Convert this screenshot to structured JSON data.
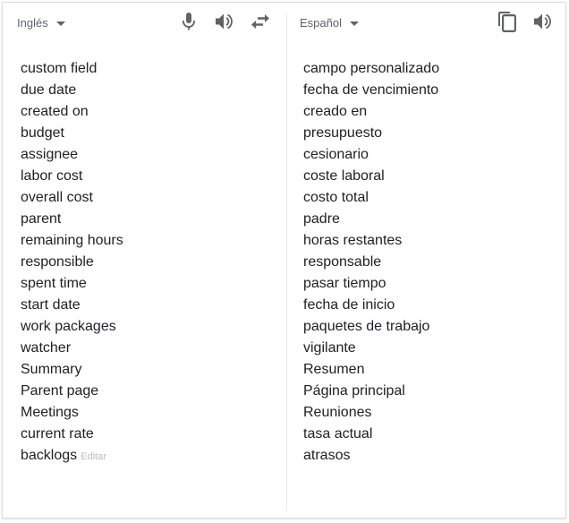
{
  "source": {
    "language": "Inglés",
    "lines": [
      "custom field",
      "due date",
      "created on",
      "budget",
      "assignee",
      "labor cost",
      "overall cost",
      "parent",
      "remaining hours",
      "responsible",
      "spent time",
      "start date",
      "work packages",
      "watcher",
      "Summary",
      "Parent page",
      "Meetings",
      "current rate",
      "backlogs"
    ],
    "edit_label": "Editar"
  },
  "target": {
    "language": "Español",
    "lines": [
      "campo personalizado",
      "fecha de vencimiento",
      "creado en",
      "presupuesto",
      "cesionario",
      "coste laboral",
      "costo total",
      "padre",
      "horas restantes",
      "responsable",
      "pasar tiempo",
      "fecha de inicio",
      "paquetes de trabajo",
      "vigilante",
      "Resumen",
      "Página principal",
      "Reuniones",
      "tasa actual",
      "atrasos"
    ]
  },
  "icons": {
    "mic": "microphone-icon",
    "speaker": "speaker-icon",
    "swap": "swap-languages-icon",
    "copy": "copy-icon"
  },
  "colors": {
    "icon": "#5f6368",
    "text": "#202124",
    "muted": "#bdbdbd",
    "border": "#dadce0"
  }
}
